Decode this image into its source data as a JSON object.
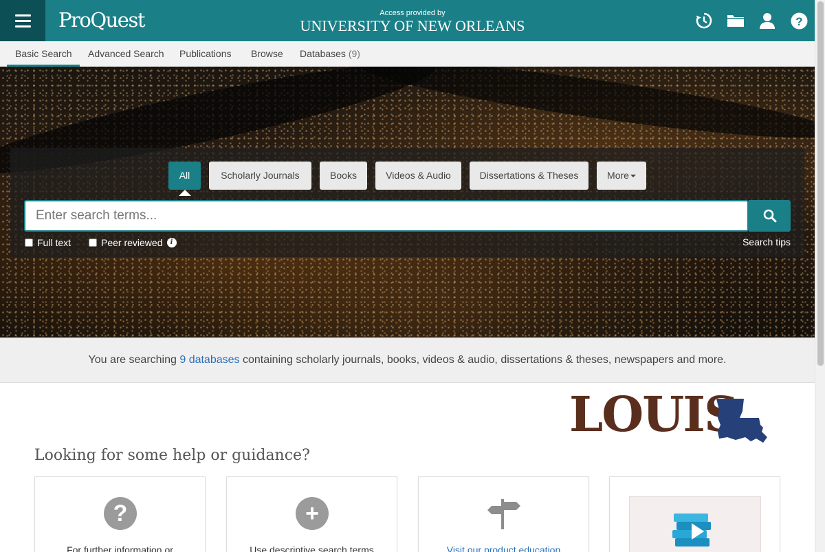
{
  "header": {
    "logo": "ProQuest",
    "access_label": "Access provided by",
    "institution": "UNIVERSITY OF NEW ORLEANS",
    "icons": [
      "history-icon",
      "folder-icon",
      "user-icon",
      "help-icon"
    ]
  },
  "nav": {
    "items": [
      {
        "label": "Basic Search"
      },
      {
        "label": "Advanced Search"
      },
      {
        "label": "Publications"
      },
      {
        "label": "Browse"
      },
      {
        "label": "Databases",
        "count": "(9)"
      }
    ]
  },
  "search": {
    "tabs": [
      "All",
      "Scholarly Journals",
      "Books",
      "Videos & Audio",
      "Dissertations & Theses",
      "More"
    ],
    "placeholder": "Enter search terms...",
    "options": [
      "Full text",
      "Peer reviewed"
    ],
    "tips": "Search tips"
  },
  "info": {
    "prefix": "You are searching",
    "link": "9 databases",
    "suffix": "containing scholarly journals, books, videos & audio, dissertations & theses, newspapers and more."
  },
  "brand_logo": {
    "text": "LOUIS"
  },
  "help": {
    "heading": "Looking for some help or guidance?",
    "cards": [
      {
        "icon": "question-icon",
        "text": "For further information or"
      },
      {
        "icon": "plus-icon",
        "text": "Use descriptive search terms"
      },
      {
        "icon": "signpost-icon",
        "text": "Visit our product education"
      },
      {
        "icon": "books-video-icon",
        "text": ""
      }
    ]
  },
  "colors": {
    "brand": "#1a7f87",
    "brand_dark": "#0c4f55",
    "link": "#2a6ebb"
  }
}
